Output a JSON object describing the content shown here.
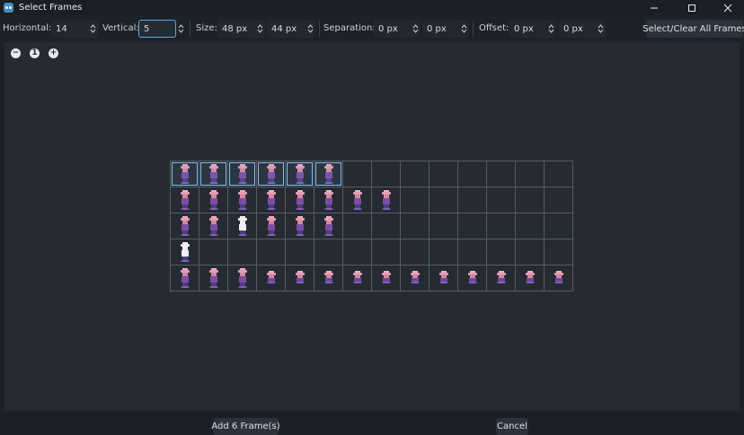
{
  "window": {
    "title": "Select Frames",
    "icon": "godot-icon",
    "controls": [
      "minimize-icon",
      "maximize-icon",
      "close-icon"
    ]
  },
  "toolbar": {
    "horizontal_label": "Horizontal:",
    "horizontal_value": "14",
    "vertical_label": "Vertical:",
    "vertical_value": "5",
    "size_label": "Size:",
    "size_x": "48 px",
    "size_y": "44 px",
    "separation_label": "Separation:",
    "separation_x": "0 px",
    "separation_y": "0 px",
    "offset_label": "Offset:",
    "offset_x": "0 px",
    "offset_y": "0 px",
    "select_all_label": "Select/Clear All Frames"
  },
  "zoom": {
    "zoom_out": "−",
    "zoom_reset": "1",
    "zoom_in": "+"
  },
  "grid": {
    "columns": 14,
    "rows": 5,
    "selected_count": 6,
    "row_frames": [
      6,
      8,
      6,
      1,
      14
    ],
    "colors": {
      "selected_border": "#7fc2ef",
      "grid_line": "#555b64"
    }
  },
  "footer": {
    "add_label": "Add 6 Frame(s)",
    "cancel_label": "Cancel"
  }
}
